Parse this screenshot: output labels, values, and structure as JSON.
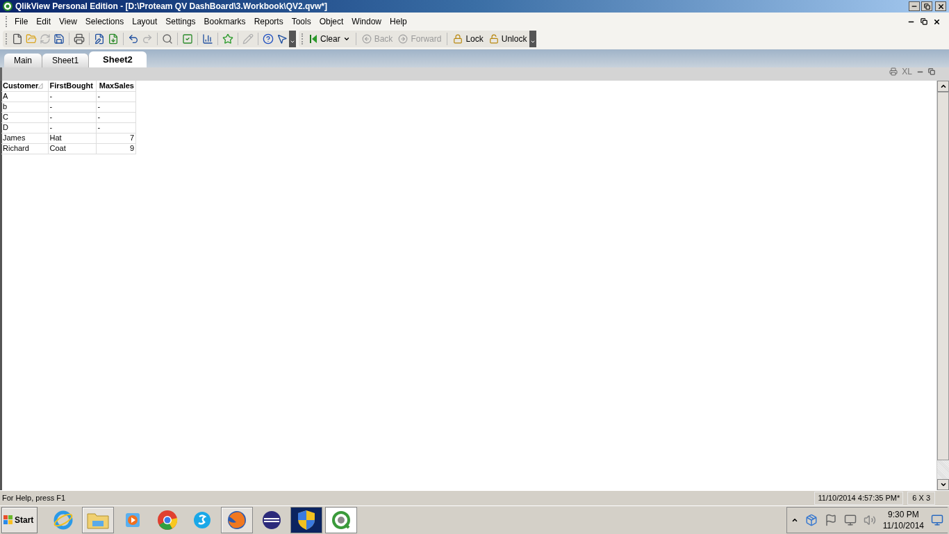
{
  "window": {
    "title": "QlikView Personal Edition - [D:\\Proteam QV DashBoard\\3.Workbook\\QV2.qvw*]"
  },
  "menu": [
    "File",
    "Edit",
    "View",
    "Selections",
    "Layout",
    "Settings",
    "Bookmarks",
    "Reports",
    "Tools",
    "Object",
    "Window",
    "Help"
  ],
  "toolbar": {
    "buttons": [
      {
        "kind": "clear",
        "label": "Clear",
        "disabled": false
      },
      {
        "kind": "back",
        "label": "Back",
        "disabled": true
      },
      {
        "kind": "forward",
        "label": "Forward",
        "disabled": true
      },
      {
        "kind": "lock",
        "label": "Lock",
        "disabled": false
      },
      {
        "kind": "unlock",
        "label": "Unlock",
        "disabled": false
      }
    ]
  },
  "tabs": [
    {
      "label": "Main",
      "selected": false
    },
    {
      "label": "Sheet1",
      "selected": false
    },
    {
      "label": "Sheet2",
      "selected": true
    }
  ],
  "object_caption": {
    "xl": "XL"
  },
  "table": {
    "columns": [
      {
        "label": "Customer",
        "sorted": true,
        "kind": "text"
      },
      {
        "label": "FirstBought",
        "sorted": false,
        "kind": "text"
      },
      {
        "label": "MaxSales",
        "sorted": false,
        "kind": "number"
      }
    ],
    "rows": [
      [
        "A",
        "-",
        "-"
      ],
      [
        "b",
        "-",
        "-"
      ],
      [
        "C",
        "-",
        "-"
      ],
      [
        "D",
        "-",
        "-"
      ],
      [
        "James",
        "Hat",
        "7"
      ],
      [
        "Richard",
        "Coat",
        "9"
      ]
    ]
  },
  "status_bar": {
    "help": "For Help, press F1",
    "timestamp": "11/10/2014 4:57:35 PM*",
    "size": "6 X 3"
  },
  "taskbar": {
    "start": "Start",
    "clock_time": "9:30 PM",
    "clock_date": "11/10/2014"
  }
}
